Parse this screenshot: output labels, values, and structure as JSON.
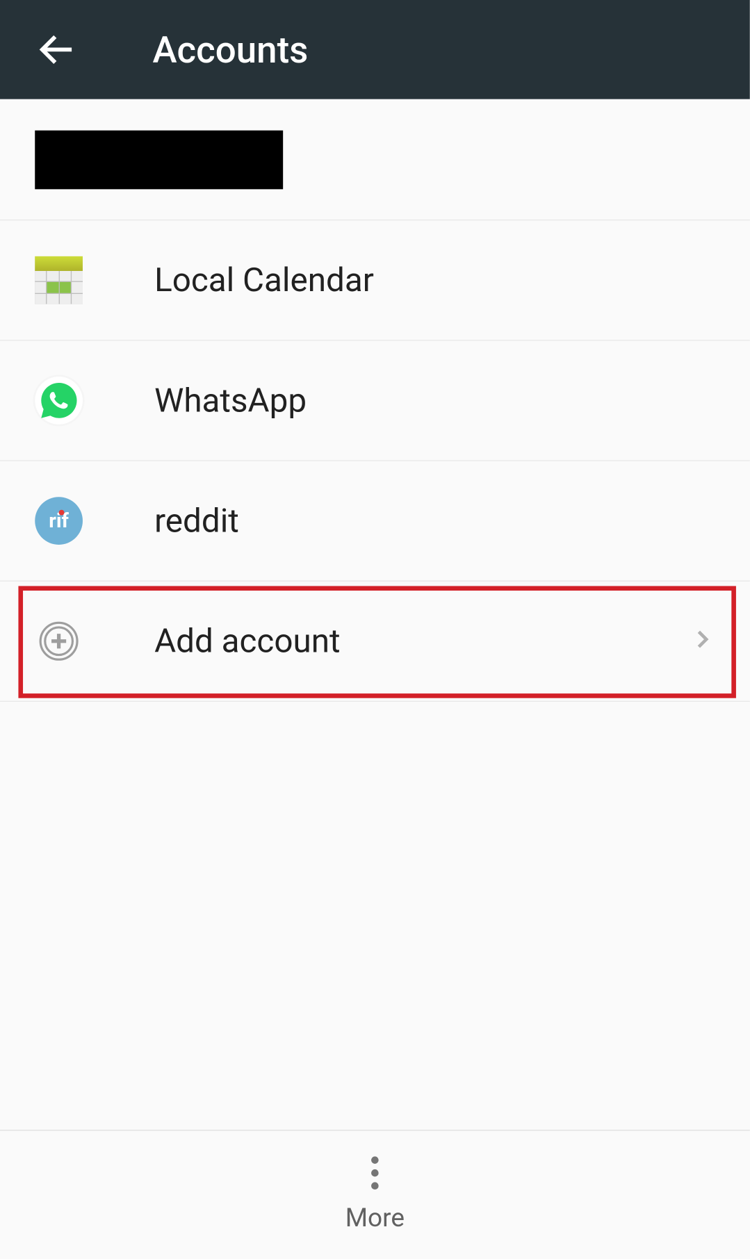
{
  "header": {
    "title": "Accounts"
  },
  "accounts": [
    {
      "label": "Local Calendar",
      "icon": "calendar-icon"
    },
    {
      "label": "WhatsApp",
      "icon": "whatsapp-icon"
    },
    {
      "label": "reddit",
      "icon": "rif-icon"
    }
  ],
  "addAccount": {
    "label": "Add account"
  },
  "rifText": "rif",
  "bottom": {
    "moreLabel": "More"
  }
}
